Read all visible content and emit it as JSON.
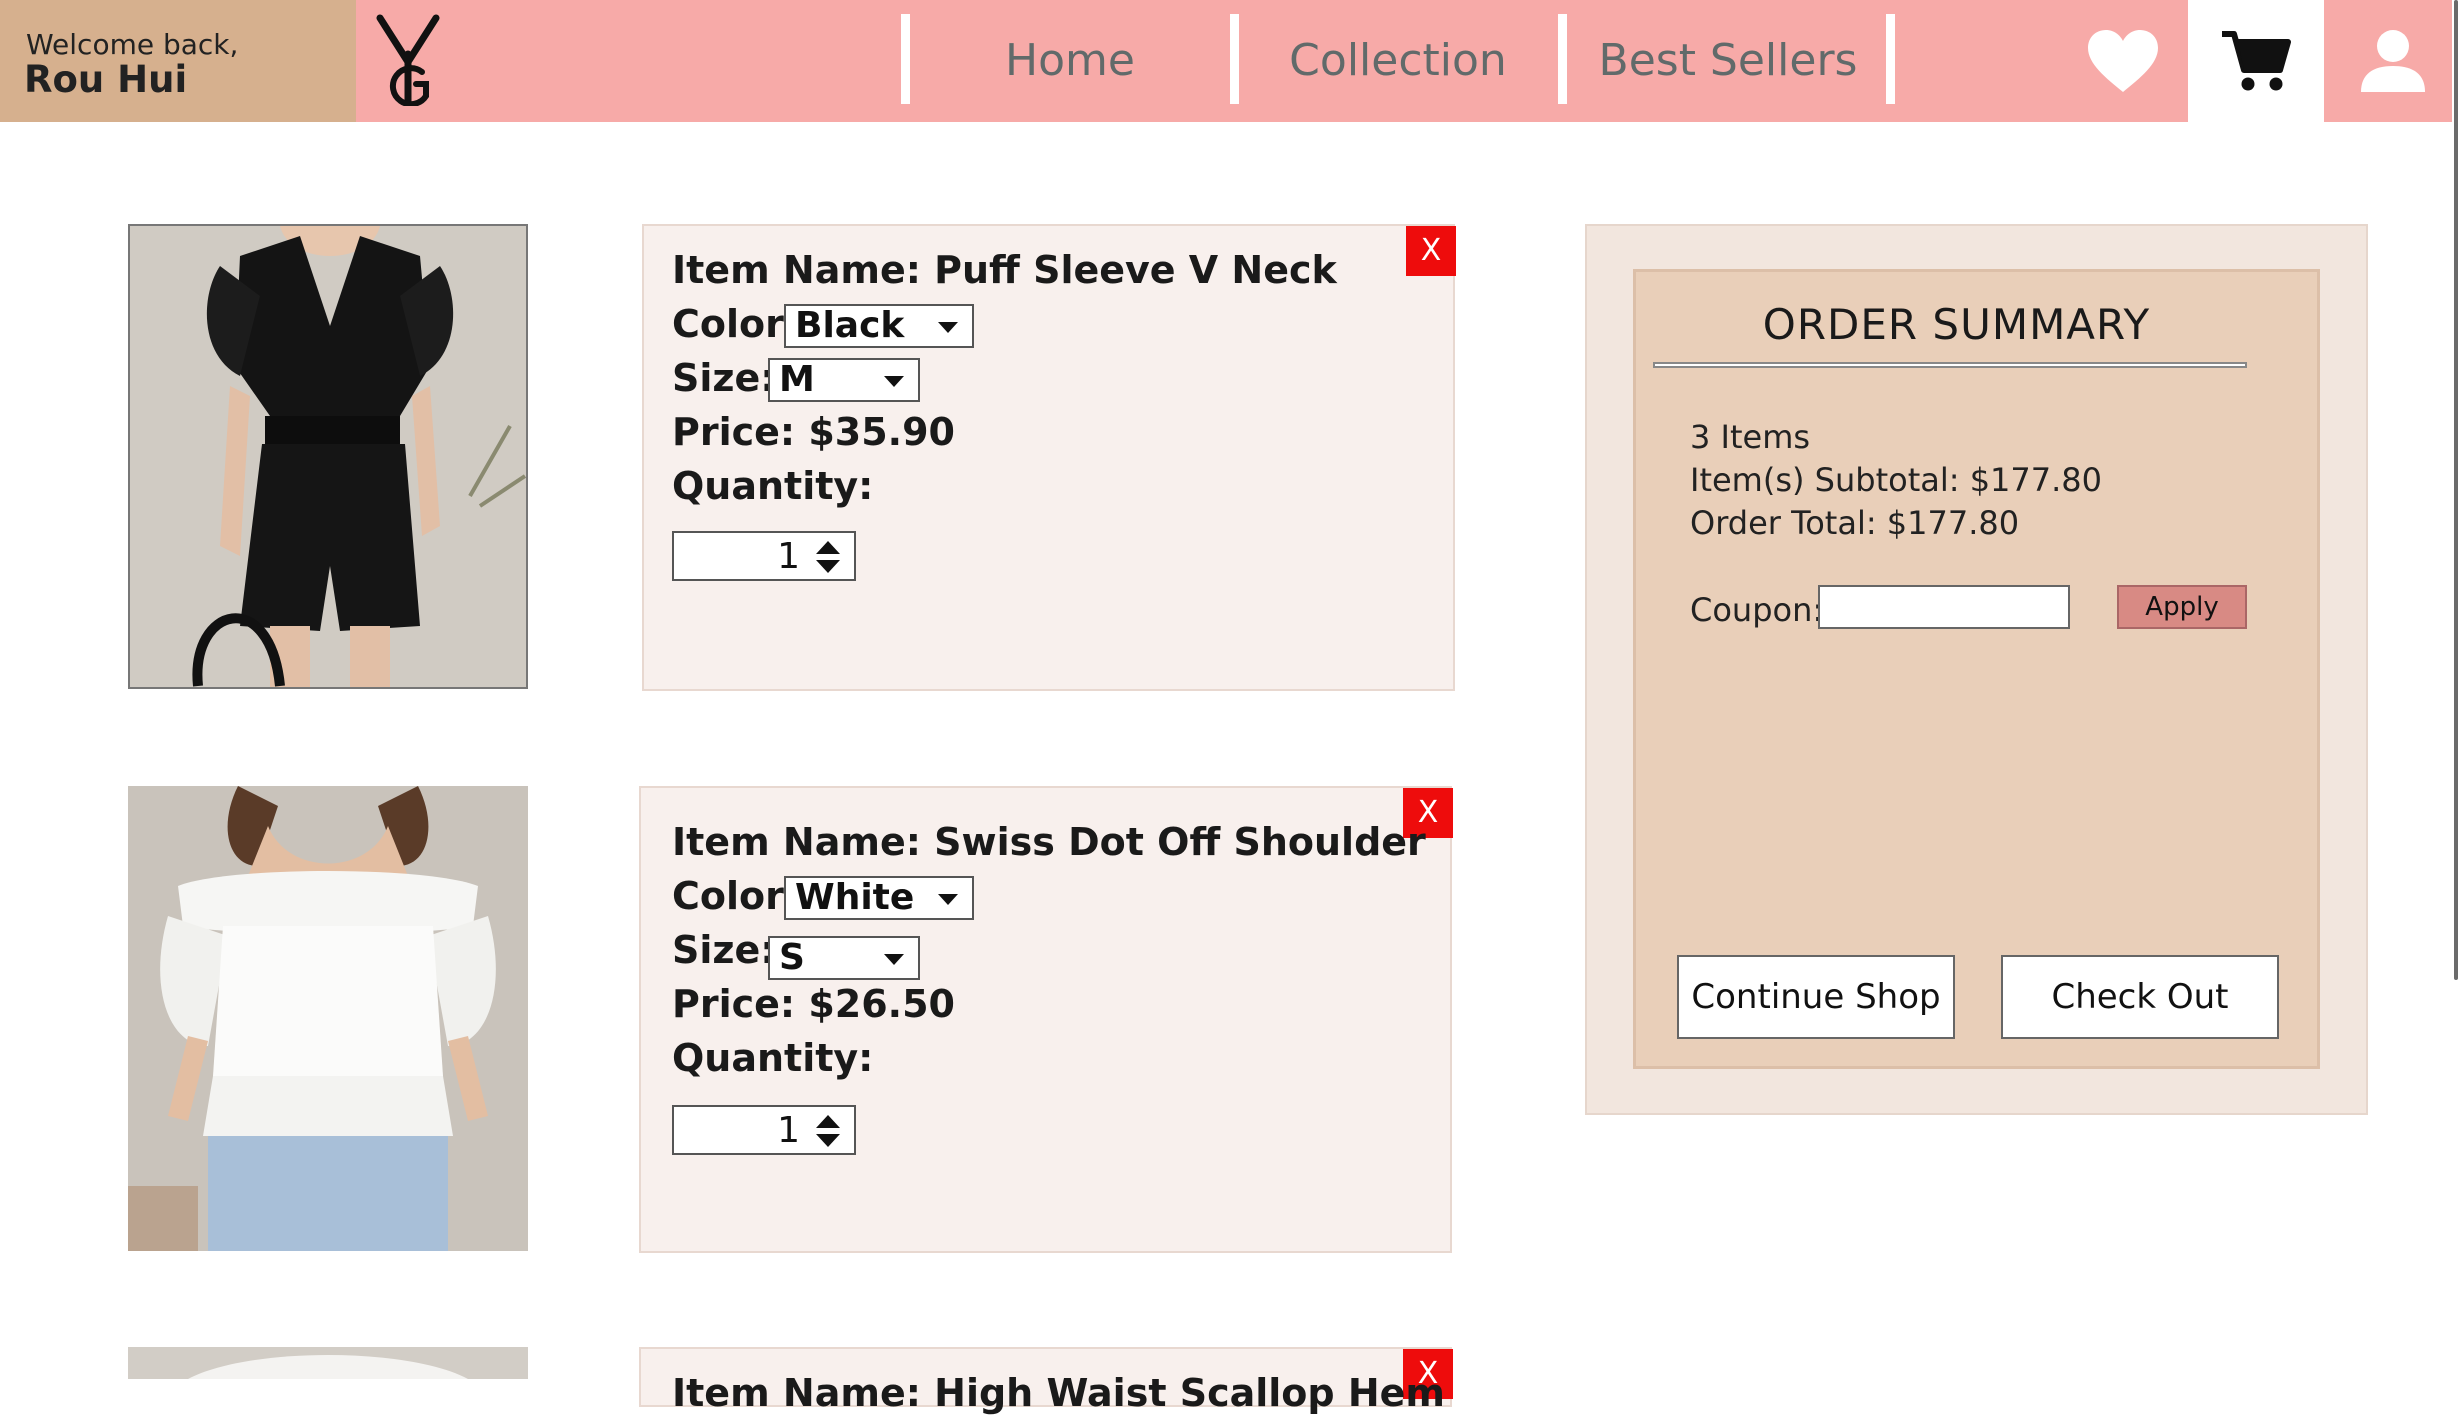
{
  "header": {
    "welcome_label": "Welcome back,",
    "user_name": "Rou Hui",
    "nav": [
      "Home",
      "Collection",
      "Best Sellers"
    ]
  },
  "cart_items": [
    {
      "name_label": "Item Name:",
      "name": "Puff Sleeve V Neck",
      "color_label": "Color:",
      "color": "Black",
      "size_label": "Size:",
      "size": "M",
      "price_label": "Price:",
      "price": "$35.90",
      "quantity_label": "Quantity:",
      "quantity": "1",
      "remove": "X",
      "image": "black puff sleeve romper"
    },
    {
      "name_label": "Item Name:",
      "name": "Swiss Dot Off Shoulder",
      "color_label": "Color:",
      "color": "White",
      "size_label": "Size:",
      "size": "S",
      "price_label": "Price:",
      "price": "$26.50",
      "quantity_label": "Quantity:",
      "quantity": "1",
      "remove": "X",
      "image": "white off-shoulder blouse"
    },
    {
      "name_label": "Item Name:",
      "name": "High Waist Scallop Hem",
      "remove": "X",
      "image": "white top (partially visible)"
    }
  ],
  "summary": {
    "title": "ORDER SUMMARY",
    "items_count": "3 Items",
    "subtotal": "Item(s) Subtotal: $177.80",
    "total": "Order Total: $177.80",
    "coupon_label": "Coupon:",
    "coupon_value": "",
    "apply": "Apply",
    "continue": "Continue Shop",
    "checkout": "Check Out"
  },
  "colors": {
    "header_bg": "#f7aaa8",
    "welcome_bg": "#d6b08e",
    "remove_red": "#ee0c0c",
    "apply_btn": "#d88a84",
    "summary_inner": "#e9cfb9",
    "card_bg": "#f8f0ed"
  },
  "icons": [
    "logo-yg",
    "heart-icon",
    "cart-icon",
    "user-icon",
    "close-icon",
    "dropdown-caret-icon",
    "spinner-icon"
  ]
}
